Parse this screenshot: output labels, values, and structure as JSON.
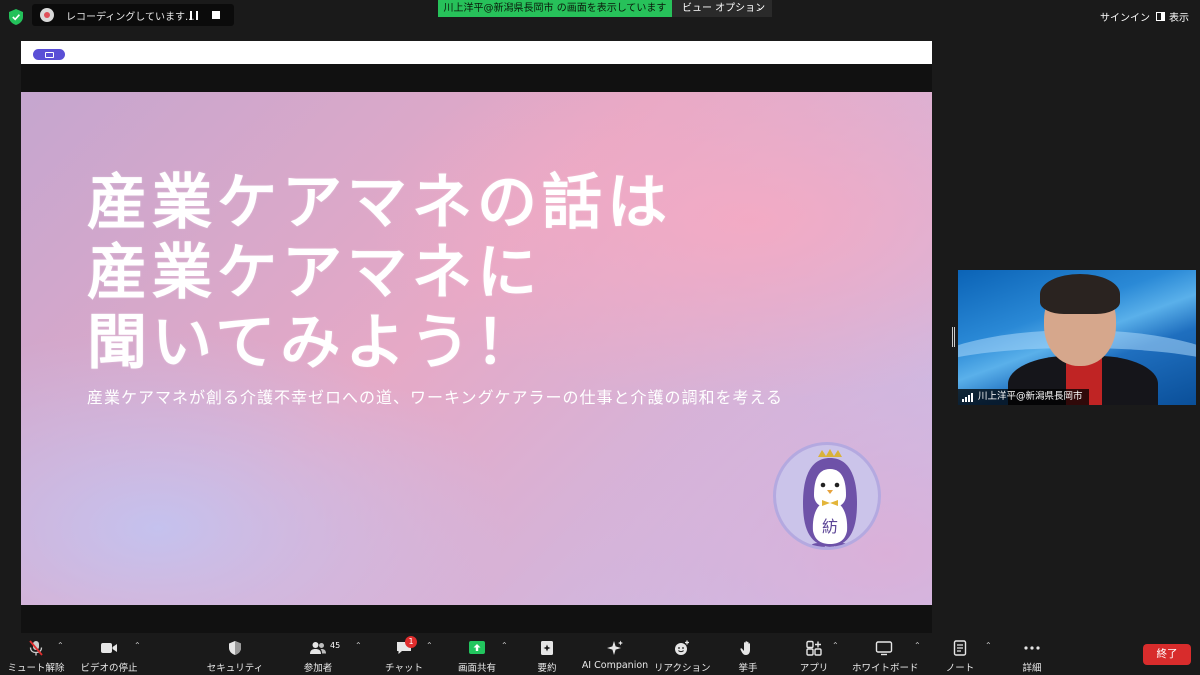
{
  "top_bar": {
    "recording_text": "レコーディングしています...",
    "share_banner": "川上洋平@新潟県長岡市 の画面を表示しています",
    "view_options": "ビュー オプション",
    "sign_in": "サインイン",
    "display": "表示"
  },
  "slide": {
    "title_line1": "産業ケアマネの話は",
    "title_line2": "産業ケアマネに",
    "title_line3": "聞いてみよう！",
    "subtitle": "産業ケアマネが創る介護不幸ゼロへの道、ワーキングケアラーの仕事と介護の調和を考える",
    "mascot_char": "紡"
  },
  "participant": {
    "name": "川上洋平@新潟県長岡市"
  },
  "toolbar": {
    "mute": "ミュート解除",
    "video": "ビデオの停止",
    "security": "セキュリティ",
    "participants": "参加者",
    "participants_count": "45",
    "chat": "チャット",
    "chat_badge": "1",
    "share": "画面共有",
    "summary": "要約",
    "ai_companion": "AI Companion",
    "reactions": "リアクション",
    "raise_hand": "挙手",
    "apps": "アプリ",
    "whiteboard": "ホワイトボード",
    "notes": "ノート",
    "more": "詳細",
    "end": "終了"
  },
  "colors": {
    "share_banner": "#27c15a",
    "end_button": "#d82c2c",
    "chat_badge": "#e02d2d",
    "share_icon": "#22c55e"
  }
}
